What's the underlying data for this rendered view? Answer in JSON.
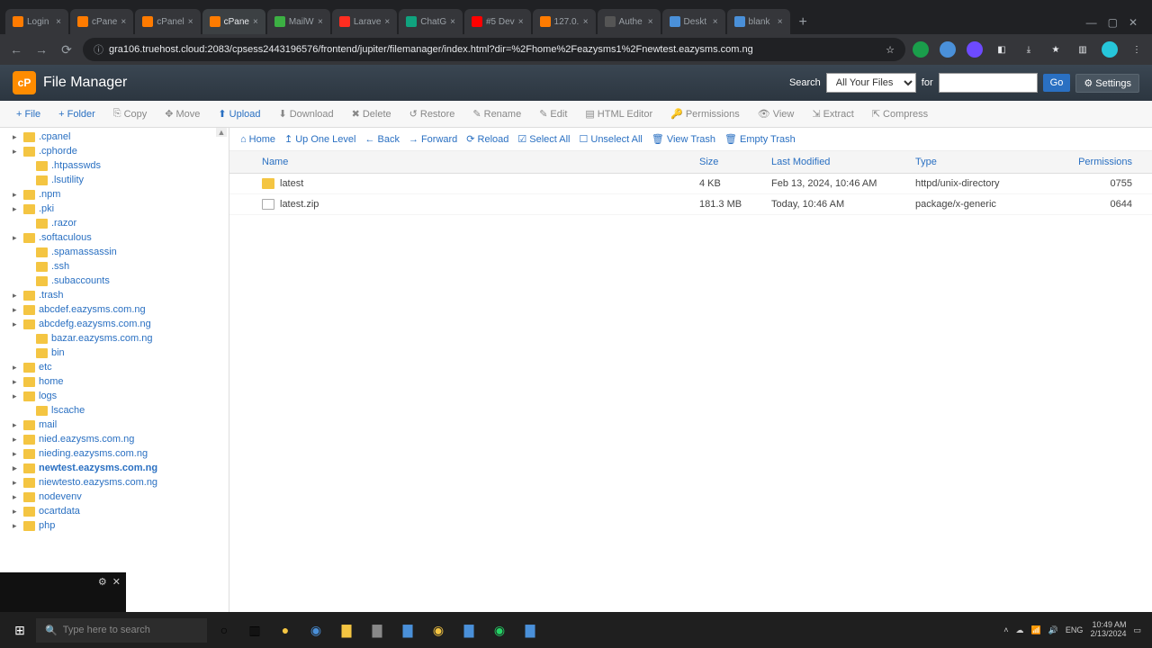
{
  "browser": {
    "tabs": [
      {
        "label": "Login",
        "icon": "#ff7b00"
      },
      {
        "label": "cPane",
        "icon": "#ff7b00"
      },
      {
        "label": "cPanel",
        "icon": "#ff7b00"
      },
      {
        "label": "cPane",
        "icon": "#ff7b00",
        "active": true
      },
      {
        "label": "MailW",
        "icon": "#3cb043"
      },
      {
        "label": "Larave",
        "icon": "#ff2d20"
      },
      {
        "label": "ChatG",
        "icon": "#10a37f"
      },
      {
        "label": "#5 Dev",
        "icon": "#ff0000"
      },
      {
        "label": "127.0.",
        "icon": "#ff7b00"
      },
      {
        "label": "Authe",
        "icon": "#555"
      },
      {
        "label": "Deskt",
        "icon": "#4a90d9"
      },
      {
        "label": "blank",
        "icon": "#4a90d9"
      }
    ],
    "url": "gra106.truehost.cloud:2083/cpsess2443196576/frontend/jupiter/filemanager/index.html?dir=%2Fhome%2Feazysms1%2Fnewtest.eazysms.com.ng"
  },
  "header": {
    "title": "File Manager",
    "search_label": "Search",
    "search_scope": "All Your Files",
    "for_label": "for",
    "go": "Go",
    "settings": "Settings"
  },
  "toolbar": {
    "file": "File",
    "folder": "Folder",
    "copy": "Copy",
    "move": "Move",
    "upload": "Upload",
    "download": "Download",
    "delete": "Delete",
    "restore": "Restore",
    "rename": "Rename",
    "edit": "Edit",
    "html": "HTML Editor",
    "perm": "Permissions",
    "view": "View",
    "extract": "Extract",
    "compress": "Compress"
  },
  "nav": {
    "home": "Home",
    "up": "Up One Level",
    "back": "Back",
    "forward": "Forward",
    "reload": "Reload",
    "selectall": "Select All",
    "unselect": "Unselect All",
    "trash": "View Trash",
    "empty": "Empty Trash"
  },
  "columns": {
    "name": "Name",
    "size": "Size",
    "mod": "Last Modified",
    "type": "Type",
    "perm": "Permissions"
  },
  "files": [
    {
      "name": "latest",
      "size": "4 KB",
      "mod": "Feb 13, 2024, 10:46 AM",
      "type": "httpd/unix-directory",
      "perm": "0755",
      "kind": "folder"
    },
    {
      "name": "latest.zip",
      "size": "181.3 MB",
      "mod": "Today, 10:46 AM",
      "type": "package/x-generic",
      "perm": "0644",
      "kind": "file"
    }
  ],
  "tree": [
    {
      "label": ".cpanel",
      "lvl": 1,
      "tg": "+"
    },
    {
      "label": ".cphorde",
      "lvl": 1,
      "tg": "+"
    },
    {
      "label": ".htpasswds",
      "lvl": 2
    },
    {
      "label": ".lsutility",
      "lvl": 2
    },
    {
      "label": ".npm",
      "lvl": 1,
      "tg": "+"
    },
    {
      "label": ".pki",
      "lvl": 1,
      "tg": "+"
    },
    {
      "label": ".razor",
      "lvl": 2
    },
    {
      "label": ".softaculous",
      "lvl": 1,
      "tg": "+"
    },
    {
      "label": ".spamassassin",
      "lvl": 2
    },
    {
      "label": ".ssh",
      "lvl": 2
    },
    {
      "label": ".subaccounts",
      "lvl": 2
    },
    {
      "label": ".trash",
      "lvl": 1,
      "tg": "+"
    },
    {
      "label": "abcdef.eazysms.com.ng",
      "lvl": 1,
      "tg": "+"
    },
    {
      "label": "abcdefg.eazysms.com.ng",
      "lvl": 1,
      "tg": "+"
    },
    {
      "label": "bazar.eazysms.com.ng",
      "lvl": 2
    },
    {
      "label": "bin",
      "lvl": 2
    },
    {
      "label": "etc",
      "lvl": 1,
      "tg": "+"
    },
    {
      "label": "home",
      "lvl": 1,
      "tg": "+"
    },
    {
      "label": "logs",
      "lvl": 1,
      "tg": "+"
    },
    {
      "label": "lscache",
      "lvl": 2
    },
    {
      "label": "mail",
      "lvl": 1,
      "tg": "+"
    },
    {
      "label": "nied.eazysms.com.ng",
      "lvl": 1,
      "tg": "+"
    },
    {
      "label": "nieding.eazysms.com.ng",
      "lvl": 1,
      "tg": "+"
    },
    {
      "label": "newtest.eazysms.com.ng",
      "lvl": 1,
      "tg": "+",
      "bold": true
    },
    {
      "label": "niewtesto.eazysms.com.ng",
      "lvl": 1,
      "tg": "+"
    },
    {
      "label": "nodevenv",
      "lvl": 1,
      "tg": "+"
    },
    {
      "label": "ocartdata",
      "lvl": 1,
      "tg": "+"
    },
    {
      "label": "php",
      "lvl": 1,
      "tg": "+"
    }
  ],
  "taskbar": {
    "search_placeholder": "Type here to search",
    "time": "10:49 AM",
    "date": "2/13/2024",
    "lang": "ENG"
  }
}
